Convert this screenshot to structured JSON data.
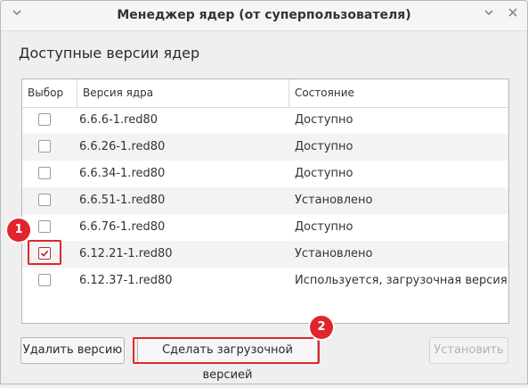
{
  "window": {
    "title": "Менеджер ядер (от суперпользователя)",
    "close_icon": "close-icon",
    "menu_icon": "chevron-down-icon"
  },
  "section_title": "Доступные версии ядер",
  "table": {
    "columns": [
      "Выбор",
      "Версия ядра",
      "Состояние"
    ],
    "rows": [
      {
        "checked": false,
        "version": "6.6.6-1.red80",
        "status": "Доступно"
      },
      {
        "checked": false,
        "version": "6.6.26-1.red80",
        "status": "Доступно"
      },
      {
        "checked": false,
        "version": "6.6.34-1.red80",
        "status": "Доступно"
      },
      {
        "checked": false,
        "version": "6.6.51-1.red80",
        "status": "Установлено"
      },
      {
        "checked": false,
        "version": "6.6.76-1.red80",
        "status": "Доступно"
      },
      {
        "checked": true,
        "version": "6.12.21-1.red80",
        "status": "Установлено"
      },
      {
        "checked": false,
        "version": "6.12.37-1.red80",
        "status": "Используется, загрузочная версия"
      }
    ]
  },
  "buttons": {
    "remove": "Удалить версию",
    "make_boot": "Сделать загрузочной версией",
    "install": "Установить"
  },
  "annotations": {
    "badge1": "1",
    "badge2": "2"
  },
  "colors": {
    "highlight": "#e0262c",
    "checkbox_checked": "#b0313a"
  }
}
